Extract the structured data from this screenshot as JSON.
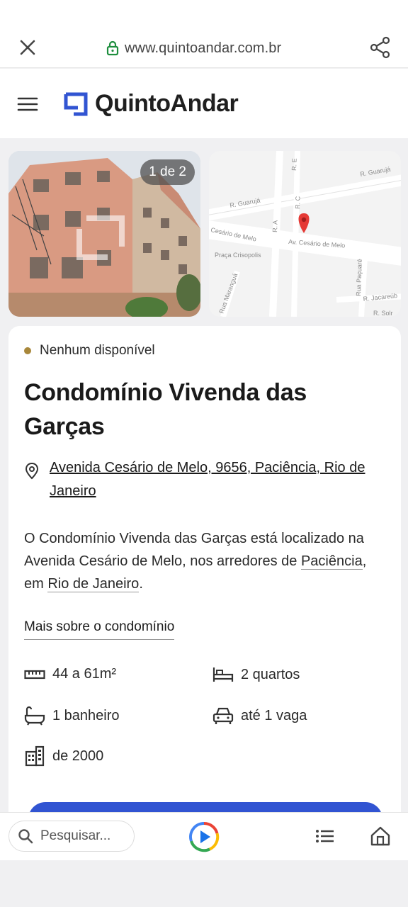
{
  "browser": {
    "url": "www.quintoandar.com.br"
  },
  "site": {
    "logo_text": "QuintoAndar",
    "brand_color": "#3154d2"
  },
  "gallery": {
    "photo_counter": "1 de 2",
    "map_labels": {
      "street_1": "R. Guarujá",
      "street_2": "R. Guarujá",
      "street_3": "Cesário de Melo",
      "street_4": "Av. Cesário de Melo",
      "square": "Praça Crisopolis",
      "street_5": "Rua Maranguá",
      "street_6": "Rua Paçuaré",
      "street_7": "R. Jacareúb",
      "street_8": "R. Solr",
      "street_9": "R. A",
      "street_10": "R. E",
      "street_11": "R. C"
    }
  },
  "listing": {
    "status": "Nenhum disponível",
    "title": "Condomínio Vivenda das Garças",
    "address": "Avenida Cesário de Melo, 9656, Paciência, Rio de Janeiro",
    "desc_part1": "O Condomínio Vivenda das Garças está localizado na Avenida Cesário de Melo, nos arredores de ",
    "desc_link1": "Paciência",
    "desc_part2": ", em ",
    "desc_link2": "Rio de Janeiro",
    "desc_part3": ".",
    "more_label": "Mais sobre o condomínio",
    "features": {
      "area": "44 a 61m²",
      "bedrooms": "2 quartos",
      "bathrooms": "1 banheiro",
      "parking": "até 1 vaga",
      "year": "de 2000"
    }
  },
  "bottom_bar": {
    "search_placeholder": "Pesquisar..."
  }
}
